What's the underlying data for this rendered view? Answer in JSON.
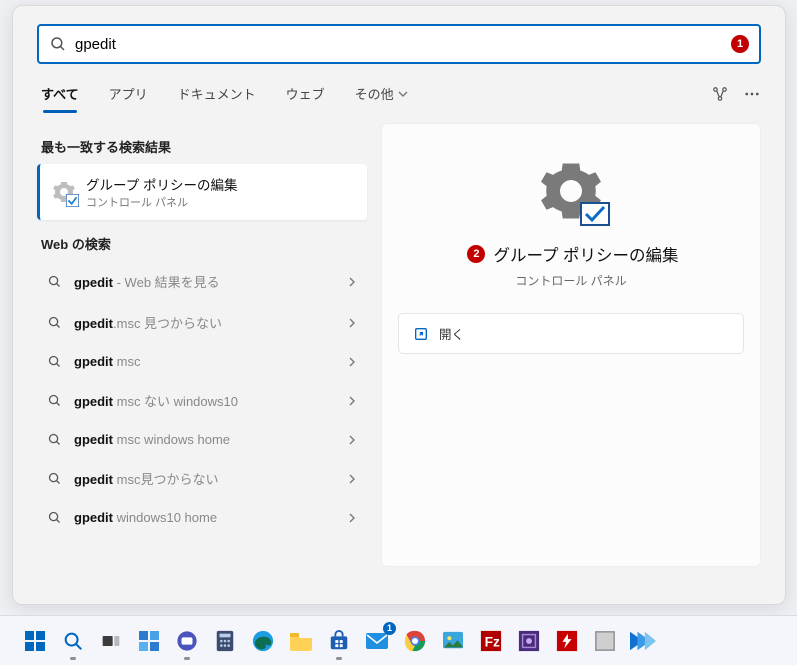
{
  "search": {
    "value": "gpedit",
    "badge": "1"
  },
  "tabs": {
    "all": "すべて",
    "apps": "アプリ",
    "docs": "ドキュメント",
    "web": "ウェブ",
    "more": "その他"
  },
  "left": {
    "bestHeader": "最も一致する検索結果",
    "bestTitle": "グループ ポリシーの編集",
    "bestSub": "コントロール パネル",
    "webHeader": "Web の検索",
    "items": [
      {
        "main": "gpedit",
        "suffix": " - Web 結果を見る"
      },
      {
        "main": "gpedit",
        "suffix": ".msc 見つからない"
      },
      {
        "main": "gpedit",
        "suffix": " msc"
      },
      {
        "main": "gpedit",
        "suffix": " msc ない windows10"
      },
      {
        "main": "gpedit",
        "suffix": " msc windows home"
      },
      {
        "main": "gpedit",
        "suffix": " msc見つからない"
      },
      {
        "main": "gpedit",
        "suffix": " windows10 home"
      }
    ]
  },
  "right": {
    "badge": "2",
    "title": "グループ ポリシーの編集",
    "sub": "コントロール パネル",
    "open": "開く"
  },
  "taskbar": {
    "mailBadge": "1"
  }
}
